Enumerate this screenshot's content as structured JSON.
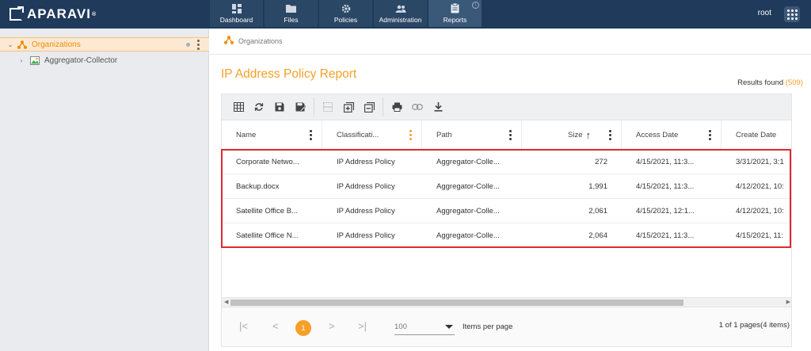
{
  "app": {
    "brand": "APARAVI",
    "brand_mark": "®",
    "user": "root"
  },
  "nav": [
    {
      "label": "Dashboard",
      "icon": "dashboard-icon"
    },
    {
      "label": "Files",
      "icon": "folder-icon"
    },
    {
      "label": "Policies",
      "icon": "gear-icon"
    },
    {
      "label": "Administration",
      "icon": "users-icon"
    },
    {
      "label": "Reports",
      "icon": "clipboard-icon",
      "active": true,
      "info": "i"
    }
  ],
  "sidebar": {
    "items": [
      {
        "label": "Organizations",
        "selected": true
      },
      {
        "label": "Aggregator-Collector"
      }
    ]
  },
  "breadcrumb": {
    "label": "Organizations"
  },
  "report": {
    "title": "IP Address Policy Report",
    "results_label": "Results found",
    "results_count": "(509)"
  },
  "grid": {
    "columns": [
      "Name",
      "Classificati...",
      "Path",
      "Size",
      "Access Date",
      "Create Date"
    ],
    "sort_indicator": "↑",
    "rows": [
      {
        "name": "Corporate Netwo...",
        "classification": "IP Address Policy",
        "path": "Aggregator-Colle...",
        "size": "272",
        "access": "4/15/2021, 11:3...",
        "create": "3/31/2021, 3:1"
      },
      {
        "name": "Backup.docx",
        "classification": "IP Address Policy",
        "path": "Aggregator-Colle...",
        "size": "1,991",
        "access": "4/15/2021, 11:3...",
        "create": "4/12/2021, 10:"
      },
      {
        "name": "Satellite Office B...",
        "classification": "IP Address Policy",
        "path": "Aggregator-Colle...",
        "size": "2,061",
        "access": "4/15/2021, 12:1...",
        "create": "4/12/2021, 10:"
      },
      {
        "name": "Satellite Office N...",
        "classification": "IP Address Policy",
        "path": "Aggregator-Colle...",
        "size": "2,064",
        "access": "4/15/2021, 11:3...",
        "create": "4/15/2021, 11:"
      }
    ]
  },
  "pager": {
    "first": "|<",
    "prev": "<",
    "current": "1",
    "next": ">",
    "last": ">|",
    "page_size": "100",
    "page_size_label": "Items per page",
    "info": "1 of 1 pages(4 items)"
  },
  "colors": {
    "topbar": "#1f3a5a",
    "accent": "#f5a028",
    "highlight": "#e0282e"
  }
}
